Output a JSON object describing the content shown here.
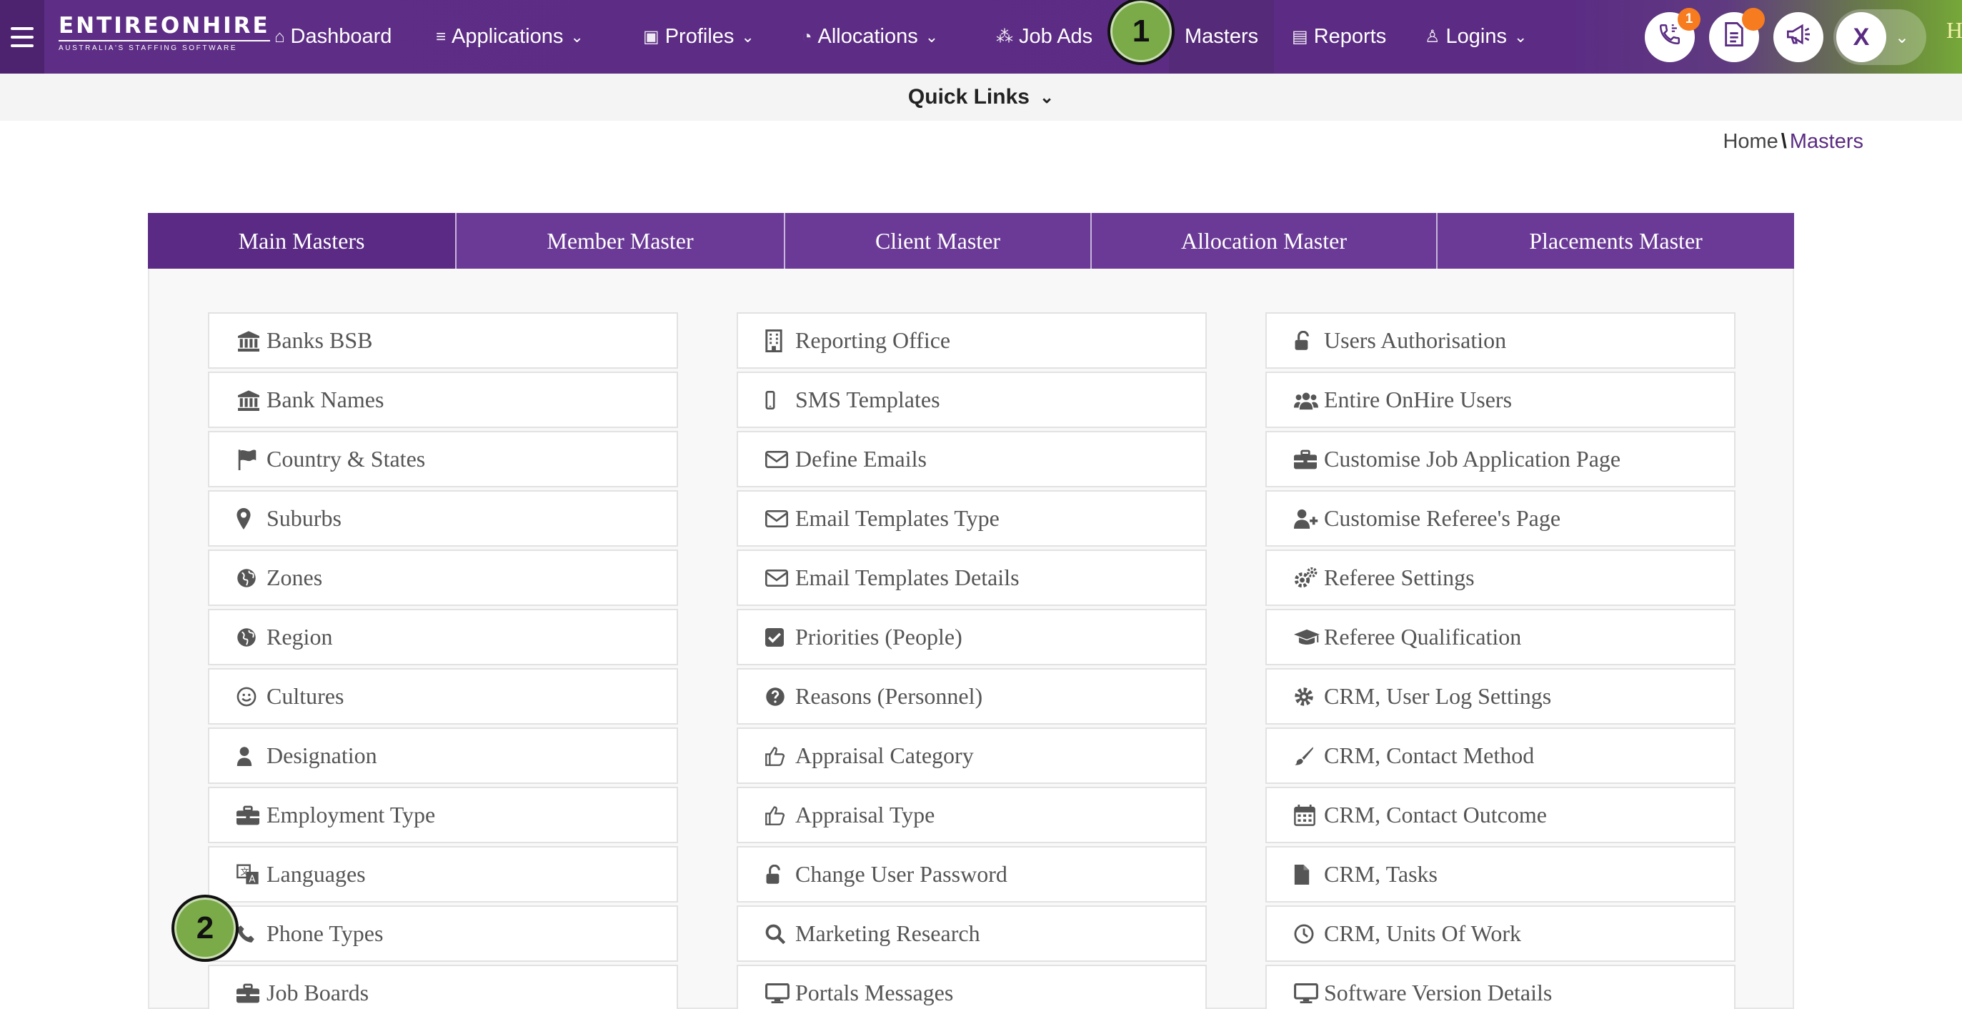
{
  "header": {
    "logo_main": "ENTIREONHIRE",
    "logo_sub": "Australia's Staffing Software",
    "nav": [
      {
        "label": "Dashboard",
        "icon": "home-icon",
        "dropdown": false
      },
      {
        "label": "Applications",
        "icon": "list-icon",
        "dropdown": true
      },
      {
        "label": "Profiles",
        "icon": "id-badge-icon",
        "dropdown": true
      },
      {
        "label": "Allocations",
        "icon": "pie-chart-icon",
        "dropdown": true
      },
      {
        "label": "Job Ads",
        "icon": "network-icon",
        "dropdown": false
      },
      {
        "label": "Masters",
        "icon": "",
        "dropdown": false,
        "active": true
      },
      {
        "label": "Reports",
        "icon": "document-icon",
        "dropdown": false
      },
      {
        "label": "Logins",
        "icon": "user-icon",
        "dropdown": true
      }
    ],
    "phone_badge": "1",
    "avatar_initial": "X",
    "trailing_text": "H"
  },
  "quick_links": {
    "label": "Quick Links"
  },
  "breadcrumb": {
    "home": "Home",
    "separator": "\\",
    "current": "Masters"
  },
  "tabs": [
    {
      "label": "Main Masters",
      "active": true
    },
    {
      "label": "Member Master"
    },
    {
      "label": "Client Master"
    },
    {
      "label": "Allocation Master"
    },
    {
      "label": "Placements Master"
    }
  ],
  "columns": [
    [
      {
        "label": "Banks BSB",
        "icon": "bank-icon"
      },
      {
        "label": "Bank Names",
        "icon": "bank-icon"
      },
      {
        "label": "Country & States",
        "icon": "flag-icon"
      },
      {
        "label": "Suburbs",
        "icon": "map-marker-icon"
      },
      {
        "label": "Zones",
        "icon": "globe-icon"
      },
      {
        "label": "Region",
        "icon": "globe-icon"
      },
      {
        "label": "Cultures",
        "icon": "smile-icon"
      },
      {
        "label": "Designation",
        "icon": "user-icon"
      },
      {
        "label": "Employment Type",
        "icon": "briefcase-icon"
      },
      {
        "label": "Languages",
        "icon": "language-icon"
      },
      {
        "label": "Phone Types",
        "icon": "phone-icon"
      },
      {
        "label": "Job Boards",
        "icon": "briefcase-icon"
      }
    ],
    [
      {
        "label": "Reporting Office",
        "icon": "building-icon"
      },
      {
        "label": "SMS Templates",
        "icon": "mobile-icon"
      },
      {
        "label": "Define Emails",
        "icon": "envelope-icon"
      },
      {
        "label": "Email Templates Type",
        "icon": "envelope-icon"
      },
      {
        "label": "Email Templates Details",
        "icon": "envelope-icon"
      },
      {
        "label": "Priorities (People)",
        "icon": "check-square-icon"
      },
      {
        "label": "Reasons (Personnel)",
        "icon": "question-circle-icon"
      },
      {
        "label": "Appraisal Category",
        "icon": "thumbs-up-icon"
      },
      {
        "label": "Appraisal Type",
        "icon": "thumbs-up-icon"
      },
      {
        "label": "Change User Password",
        "icon": "unlock-icon"
      },
      {
        "label": "Marketing Research",
        "icon": "search-icon"
      },
      {
        "label": "Portals Messages",
        "icon": "desktop-icon"
      }
    ],
    [
      {
        "label": "Users Authorisation",
        "icon": "unlock-icon"
      },
      {
        "label": "Entire OnHire Users",
        "icon": "users-icon"
      },
      {
        "label": "Customise Job Application Page",
        "icon": "briefcase-icon"
      },
      {
        "label": "Customise Referee's Page",
        "icon": "user-plus-icon"
      },
      {
        "label": "Referee Settings",
        "icon": "cogs-icon"
      },
      {
        "label": "Referee Qualification",
        "icon": "graduation-cap-icon"
      },
      {
        "label": "CRM, User Log Settings",
        "icon": "cog-icon"
      },
      {
        "label": "CRM, Contact Method",
        "icon": "paint-brush-icon"
      },
      {
        "label": "CRM, Contact Outcome",
        "icon": "calendar-icon"
      },
      {
        "label": "CRM, Tasks",
        "icon": "file-icon"
      },
      {
        "label": "CRM, Units Of Work",
        "icon": "clock-icon"
      },
      {
        "label": "Software Version Details",
        "icon": "desktop-icon"
      }
    ]
  ],
  "step_markers": [
    "1",
    "2"
  ]
}
